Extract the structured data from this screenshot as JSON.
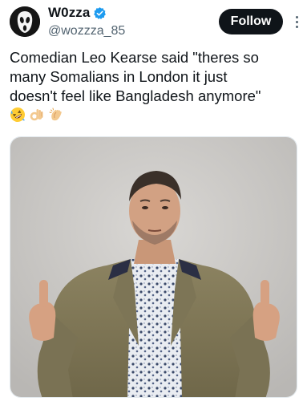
{
  "author": {
    "display_name": "W0zza",
    "handle": "@wozzza_85",
    "verified": true,
    "avatar_icon": "ghostface-mask-icon"
  },
  "actions": {
    "follow_label": "Follow",
    "more_icon": "more-vertical-icon"
  },
  "tweet": {
    "text": "Comedian Leo Kearse said \"theres so\nmany Somalians in London it just\ndoesn't feel like Bangladesh anymore\"",
    "emojis": [
      "rolling-on-floor-laughing-emoji",
      "ok-hand-emoji",
      "clapping-hands-emoji"
    ]
  },
  "media": {
    "type": "photo",
    "icon": "photo-man-middle-fingers"
  },
  "colors": {
    "text": "#0f1419",
    "secondary": "#536471",
    "verified": "#1d9bf0",
    "follow_bg": "#0f1419",
    "photo_bg": "#c9c7c4"
  }
}
